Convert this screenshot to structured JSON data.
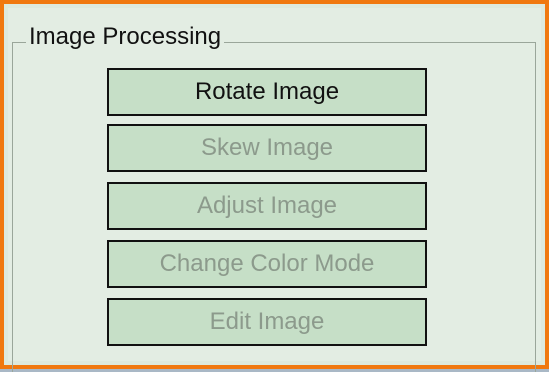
{
  "group": {
    "title": "Image Processing"
  },
  "buttons": [
    {
      "label": "Rotate Image",
      "enabled": true
    },
    {
      "label": "Skew Image",
      "enabled": false
    },
    {
      "label": "Adjust Image",
      "enabled": false
    },
    {
      "label": "Change Color Mode",
      "enabled": false
    },
    {
      "label": "Edit Image",
      "enabled": false
    }
  ],
  "colors": {
    "frame_accent": "#f0780f",
    "panel_background": "#e3ede3",
    "button_fill": "#c6dfc7",
    "enabled_text": "#111111",
    "disabled_text": "#8c9a8c"
  }
}
